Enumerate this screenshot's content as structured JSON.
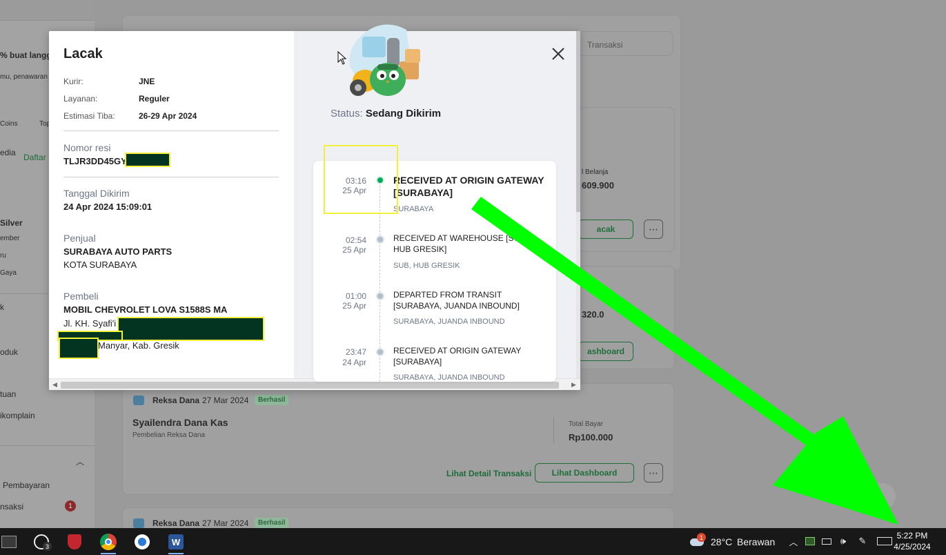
{
  "modal": {
    "title": "Lacak",
    "kurir_label": "Kurir:",
    "kurir": "JNE",
    "layanan_label": "Layanan:",
    "layanan": "Reguler",
    "estimasi_label": "Estimasi Tiba:",
    "estimasi": "26-29 Apr 2024",
    "resi_label": "Nomor resi",
    "resi": "TLJR3DD45GY",
    "tanggal_label": "Tanggal Dikirim",
    "tanggal": "24 Apr 2024 15:09:01",
    "penjual_label": "Penjual",
    "penjual_name": "SURABAYA AUTO PARTS",
    "penjual_city": "KOTA SURABAYA",
    "pembeli_label": "Pembeli",
    "pembeli_name": "MOBIL CHEVROLET LOVA S1588S MA",
    "pembeli_addr1": "Jl. KH. Syafi'i",
    "pembeli_addr2": "Manyar, Kab. Gresik",
    "status_label": "Status:",
    "status_value": "Sedang Dikirim"
  },
  "tracking": [
    {
      "time": "03:16",
      "date": "25 Apr",
      "title": "RECEIVED AT ORIGIN GATEWAY [SURABAYA]",
      "location": "SURABAYA",
      "active": true
    },
    {
      "time": "02:54",
      "date": "25 Apr",
      "title": "RECEIVED AT WAREHOUSE [SUB, HUB GRESIK]",
      "location": "SUB, HUB GRESIK",
      "active": false
    },
    {
      "time": "01:00",
      "date": "25 Apr",
      "title": "DEPARTED FROM TRANSIT [SURABAYA, JUANDA INBOUND]",
      "location": "SURABAYA, JUANDA INBOUND",
      "active": false
    },
    {
      "time": "23:47",
      "date": "24 Apr",
      "title": "RECEIVED AT ORIGIN GATEWAY [SURABAYA]",
      "location": "SURABAYA, JUANDA INBOUND",
      "active": false
    }
  ],
  "background": {
    "promo": "% buat langga",
    "promo_sub": "mu, penawaran te",
    "coins": "Coins",
    "top": "Top",
    "edia": "edia",
    "daftar": "Daftar",
    "silver": "Silver",
    "ember": "ember",
    "ru": "ru",
    "gaya": "Gaya",
    "oduk": "oduk",
    "tuan": "tuan",
    "ikomplain": "ikomplain",
    "pembayaran": "Pembayaran",
    "transaksi": "nsaksi",
    "notif_count": "1",
    "search_placeholder": "Transaksi",
    "total_belanja_label": "l Belanja",
    "total_belanja": "609.900",
    "lacak_btn": "acak",
    "amount2": "320.0",
    "dashboard_btn_partial": "ashboard",
    "reksa_label": "Reksa Dana",
    "reksa_date": "27 Mar 2024",
    "berhasil": "Berhasil",
    "fund_name": "Syailendra Dana Kas",
    "fund_sub": "Pembelian Reksa Dana",
    "total_bayar_label": "Total Bayar",
    "total_bayar": "Rp100.000",
    "detail_link": "Lihat Detail Transaksi",
    "dashboard_btn": "Lihat Dashboard",
    "reksa_label2": "Reksa Dana",
    "reksa_date2": "27 Mar 2024",
    "berhasil2": "Berhasil",
    "chat_partial": "t"
  },
  "taskbar": {
    "weather_temp": "28°C",
    "weather_desc": "Berawan",
    "weather_badge": "1",
    "chrome_badge": "3",
    "time": "5:22 PM",
    "date": "4/25/2024"
  },
  "colors": {
    "accent_green": "#00aa5b",
    "annotation_arrow": "#00ff00",
    "highlight_yellow": "#f3f03a",
    "redaction": "#033321"
  }
}
